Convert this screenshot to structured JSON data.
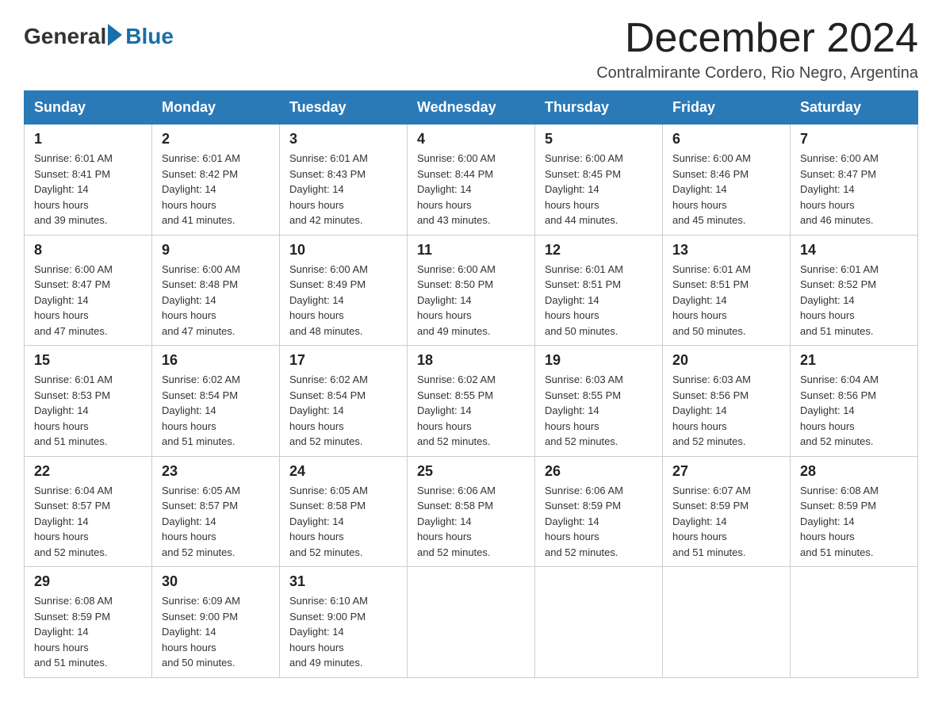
{
  "header": {
    "logo_general": "General",
    "logo_blue": "Blue",
    "month_title": "December 2024",
    "location": "Contralmirante Cordero, Rio Negro, Argentina"
  },
  "weekdays": [
    "Sunday",
    "Monday",
    "Tuesday",
    "Wednesday",
    "Thursday",
    "Friday",
    "Saturday"
  ],
  "weeks": [
    [
      {
        "day": "1",
        "sunrise": "6:01 AM",
        "sunset": "8:41 PM",
        "daylight": "14 hours and 39 minutes."
      },
      {
        "day": "2",
        "sunrise": "6:01 AM",
        "sunset": "8:42 PM",
        "daylight": "14 hours and 41 minutes."
      },
      {
        "day": "3",
        "sunrise": "6:01 AM",
        "sunset": "8:43 PM",
        "daylight": "14 hours and 42 minutes."
      },
      {
        "day": "4",
        "sunrise": "6:00 AM",
        "sunset": "8:44 PM",
        "daylight": "14 hours and 43 minutes."
      },
      {
        "day": "5",
        "sunrise": "6:00 AM",
        "sunset": "8:45 PM",
        "daylight": "14 hours and 44 minutes."
      },
      {
        "day": "6",
        "sunrise": "6:00 AM",
        "sunset": "8:46 PM",
        "daylight": "14 hours and 45 minutes."
      },
      {
        "day": "7",
        "sunrise": "6:00 AM",
        "sunset": "8:47 PM",
        "daylight": "14 hours and 46 minutes."
      }
    ],
    [
      {
        "day": "8",
        "sunrise": "6:00 AM",
        "sunset": "8:47 PM",
        "daylight": "14 hours and 47 minutes."
      },
      {
        "day": "9",
        "sunrise": "6:00 AM",
        "sunset": "8:48 PM",
        "daylight": "14 hours and 47 minutes."
      },
      {
        "day": "10",
        "sunrise": "6:00 AM",
        "sunset": "8:49 PM",
        "daylight": "14 hours and 48 minutes."
      },
      {
        "day": "11",
        "sunrise": "6:00 AM",
        "sunset": "8:50 PM",
        "daylight": "14 hours and 49 minutes."
      },
      {
        "day": "12",
        "sunrise": "6:01 AM",
        "sunset": "8:51 PM",
        "daylight": "14 hours and 50 minutes."
      },
      {
        "day": "13",
        "sunrise": "6:01 AM",
        "sunset": "8:51 PM",
        "daylight": "14 hours and 50 minutes."
      },
      {
        "day": "14",
        "sunrise": "6:01 AM",
        "sunset": "8:52 PM",
        "daylight": "14 hours and 51 minutes."
      }
    ],
    [
      {
        "day": "15",
        "sunrise": "6:01 AM",
        "sunset": "8:53 PM",
        "daylight": "14 hours and 51 minutes."
      },
      {
        "day": "16",
        "sunrise": "6:02 AM",
        "sunset": "8:54 PM",
        "daylight": "14 hours and 51 minutes."
      },
      {
        "day": "17",
        "sunrise": "6:02 AM",
        "sunset": "8:54 PM",
        "daylight": "14 hours and 52 minutes."
      },
      {
        "day": "18",
        "sunrise": "6:02 AM",
        "sunset": "8:55 PM",
        "daylight": "14 hours and 52 minutes."
      },
      {
        "day": "19",
        "sunrise": "6:03 AM",
        "sunset": "8:55 PM",
        "daylight": "14 hours and 52 minutes."
      },
      {
        "day": "20",
        "sunrise": "6:03 AM",
        "sunset": "8:56 PM",
        "daylight": "14 hours and 52 minutes."
      },
      {
        "day": "21",
        "sunrise": "6:04 AM",
        "sunset": "8:56 PM",
        "daylight": "14 hours and 52 minutes."
      }
    ],
    [
      {
        "day": "22",
        "sunrise": "6:04 AM",
        "sunset": "8:57 PM",
        "daylight": "14 hours and 52 minutes."
      },
      {
        "day": "23",
        "sunrise": "6:05 AM",
        "sunset": "8:57 PM",
        "daylight": "14 hours and 52 minutes."
      },
      {
        "day": "24",
        "sunrise": "6:05 AM",
        "sunset": "8:58 PM",
        "daylight": "14 hours and 52 minutes."
      },
      {
        "day": "25",
        "sunrise": "6:06 AM",
        "sunset": "8:58 PM",
        "daylight": "14 hours and 52 minutes."
      },
      {
        "day": "26",
        "sunrise": "6:06 AM",
        "sunset": "8:59 PM",
        "daylight": "14 hours and 52 minutes."
      },
      {
        "day": "27",
        "sunrise": "6:07 AM",
        "sunset": "8:59 PM",
        "daylight": "14 hours and 51 minutes."
      },
      {
        "day": "28",
        "sunrise": "6:08 AM",
        "sunset": "8:59 PM",
        "daylight": "14 hours and 51 minutes."
      }
    ],
    [
      {
        "day": "29",
        "sunrise": "6:08 AM",
        "sunset": "8:59 PM",
        "daylight": "14 hours and 51 minutes."
      },
      {
        "day": "30",
        "sunrise": "6:09 AM",
        "sunset": "9:00 PM",
        "daylight": "14 hours and 50 minutes."
      },
      {
        "day": "31",
        "sunrise": "6:10 AM",
        "sunset": "9:00 PM",
        "daylight": "14 hours and 49 minutes."
      },
      null,
      null,
      null,
      null
    ]
  ]
}
